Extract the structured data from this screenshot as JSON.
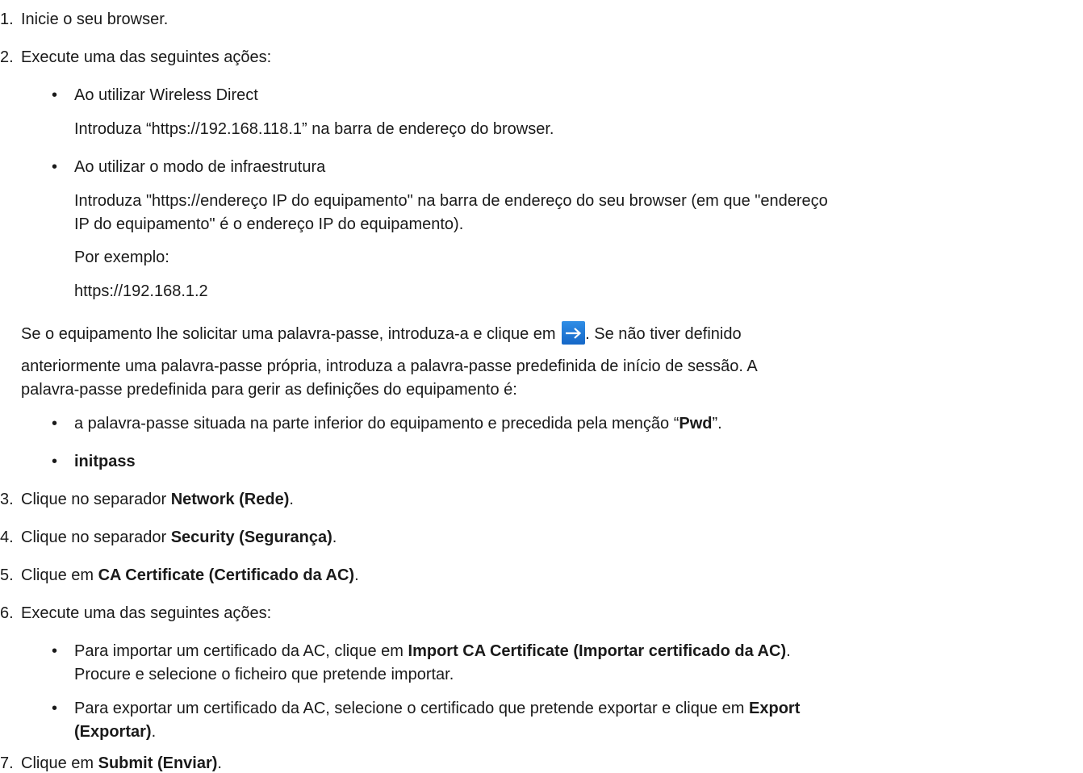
{
  "steps": {
    "s1": {
      "num": "1.",
      "text": "Inicie o seu browser."
    },
    "s2": {
      "num": "2.",
      "text": "Execute uma das seguintes ações:",
      "opt1": {
        "bullet": "•",
        "title": "Ao utilizar Wireless Direct",
        "desc": "Introduza “https://192.168.118.1” na barra de endereço do browser."
      },
      "opt2": {
        "bullet": "•",
        "title": "Ao utilizar o modo de infraestrutura",
        "desc_line1": "Introduza \"https://endereço IP do equipamento\" na barra de endereço do seu browser (em que \"endereço",
        "desc_line2": "IP do equipamento\" é o endereço IP do equipamento).",
        "example_label": "Por exemplo:",
        "example_value": "https://192.168.1.2"
      },
      "password_note": {
        "before_icon": "Se o equipamento lhe solicitar uma palavra-passe, introduza-a e clique em",
        "after_icon": ". Se não tiver definido",
        "line2": "anteriormente uma palavra-passe própria, introduza a palavra-passe predefinida de início de sessão. A",
        "line3": "palavra-passe predefinida para gerir as definições do equipamento é:"
      },
      "pwd_bullet1": {
        "bullet": "•",
        "text_before": "a palavra-passe situada na parte inferior do equipamento e precedida pela menção “",
        "bold": "Pwd",
        "text_after": "”."
      },
      "pwd_bullet2": {
        "bullet": "•",
        "bold": "initpass"
      }
    },
    "s3": {
      "num": "3.",
      "text": "Clique no separador ",
      "bold": "Network (Rede)",
      "after": "."
    },
    "s4": {
      "num": "4.",
      "text": "Clique no separador ",
      "bold": "Security (Segurança)",
      "after": "."
    },
    "s5": {
      "num": "5.",
      "text": "Clique em ",
      "bold": "CA Certificate (Certificado da AC)",
      "after": "."
    },
    "s6": {
      "num": "6.",
      "text": "Execute uma das seguintes ações:",
      "opt1": {
        "bullet": "•",
        "text": "Para importar um certificado da AC, clique em ",
        "bold": "Import CA Certificate (Importar certificado da AC)",
        "after": ".",
        "line2": "Procure e selecione o ficheiro que pretende importar."
      },
      "opt2": {
        "bullet": "•",
        "text": "Para exportar um certificado da AC, selecione o certificado que pretende exportar e clique em ",
        "bold": "Export",
        "line2_bold": "(Exportar)",
        "line2_after": "."
      }
    },
    "s7": {
      "num": "7.",
      "text": "Clique em ",
      "bold": "Submit (Enviar)",
      "after": "."
    }
  },
  "icon": {
    "name": "arrow-right-icon",
    "color": "#1e78d8"
  }
}
